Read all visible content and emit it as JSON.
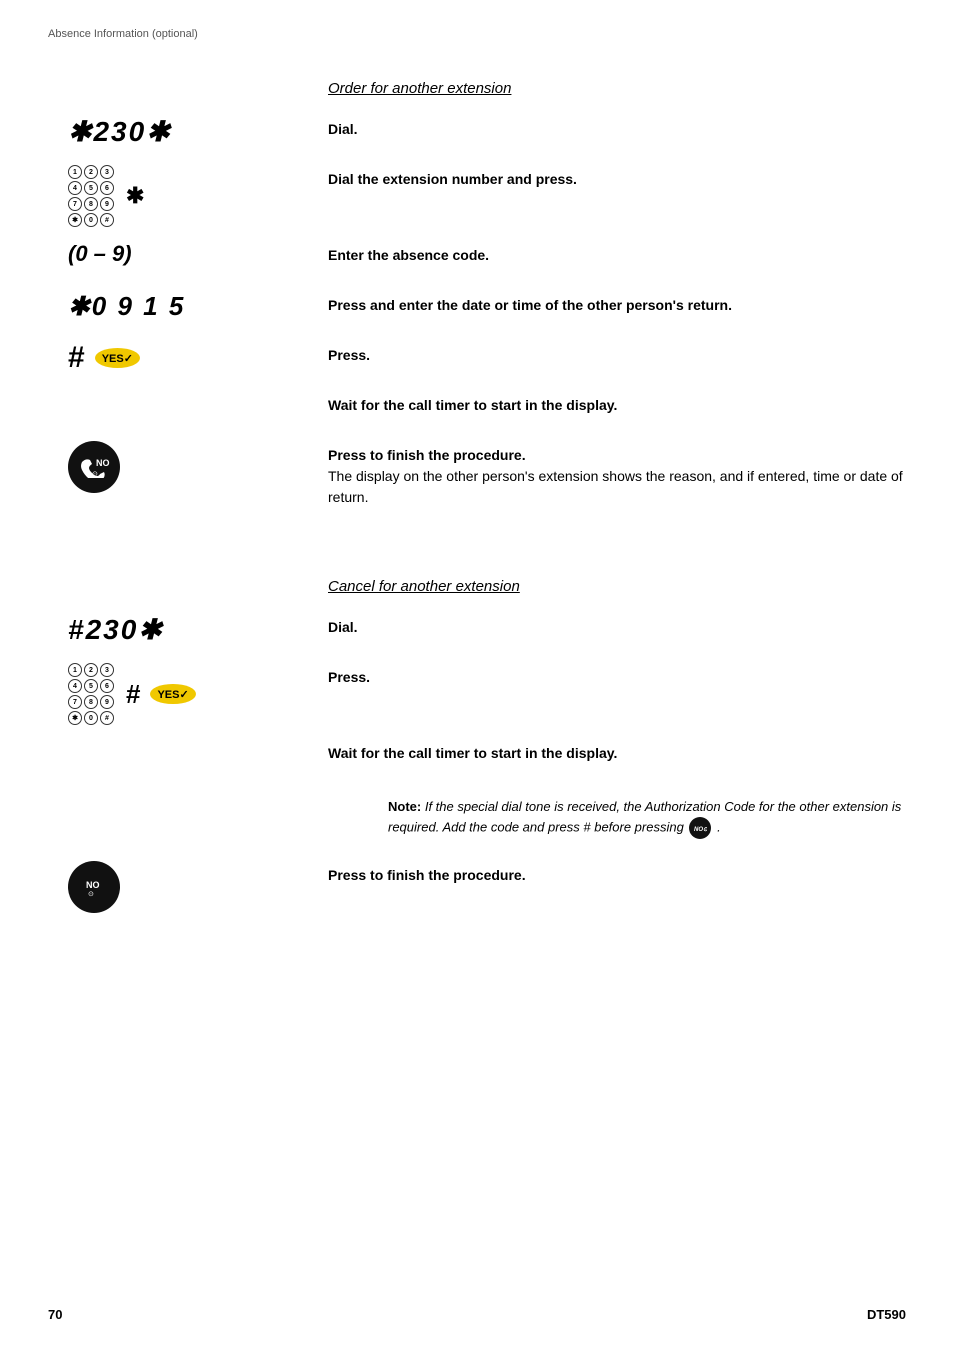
{
  "header": {
    "label": "Absence Information (optional)"
  },
  "footer": {
    "left": "70",
    "right": "DT590"
  },
  "order_section": {
    "heading": "Order for another extension",
    "rows": [
      {
        "symbol_type": "dial",
        "symbol_text": "✱230✱",
        "text": "Dial."
      },
      {
        "symbol_type": "keypad_star",
        "text": "Dial the extension number and press."
      },
      {
        "symbol_type": "paren",
        "symbol_text": "(0 – 9)",
        "text": "Enter the absence code."
      },
      {
        "symbol_type": "dial_small",
        "symbol_text": "✱0915",
        "text": "Press and enter the date or time of the other person's return."
      },
      {
        "symbol_type": "hash_yes",
        "text": "Press."
      },
      {
        "symbol_type": "empty",
        "text": "Wait for the call timer to start in the display."
      },
      {
        "symbol_type": "no_button",
        "text_bold": "Press to finish the procedure.",
        "text_normal": "The display on the other person's extension shows the reason, and if entered, time or date of return."
      }
    ]
  },
  "cancel_section": {
    "heading": "Cancel for another extension",
    "rows": [
      {
        "symbol_type": "hash_dial",
        "symbol_text": "#230✱",
        "text": "Dial."
      },
      {
        "symbol_type": "keypad_hash_yes",
        "text": "Press."
      },
      {
        "symbol_type": "empty",
        "text": "Wait for the call timer to start in the display."
      },
      {
        "symbol_type": "note",
        "note_label": "Note:",
        "note_text": " If the special dial tone is received, the Authorization Code for the other extension is required. Add the code and press # before pressing"
      },
      {
        "symbol_type": "no_button",
        "text_bold": "Press to finish the procedure."
      }
    ]
  },
  "keypad_digits": [
    "1",
    "2",
    "3",
    "4",
    "5",
    "6",
    "7",
    "8",
    "9",
    "*",
    "0",
    "#"
  ]
}
